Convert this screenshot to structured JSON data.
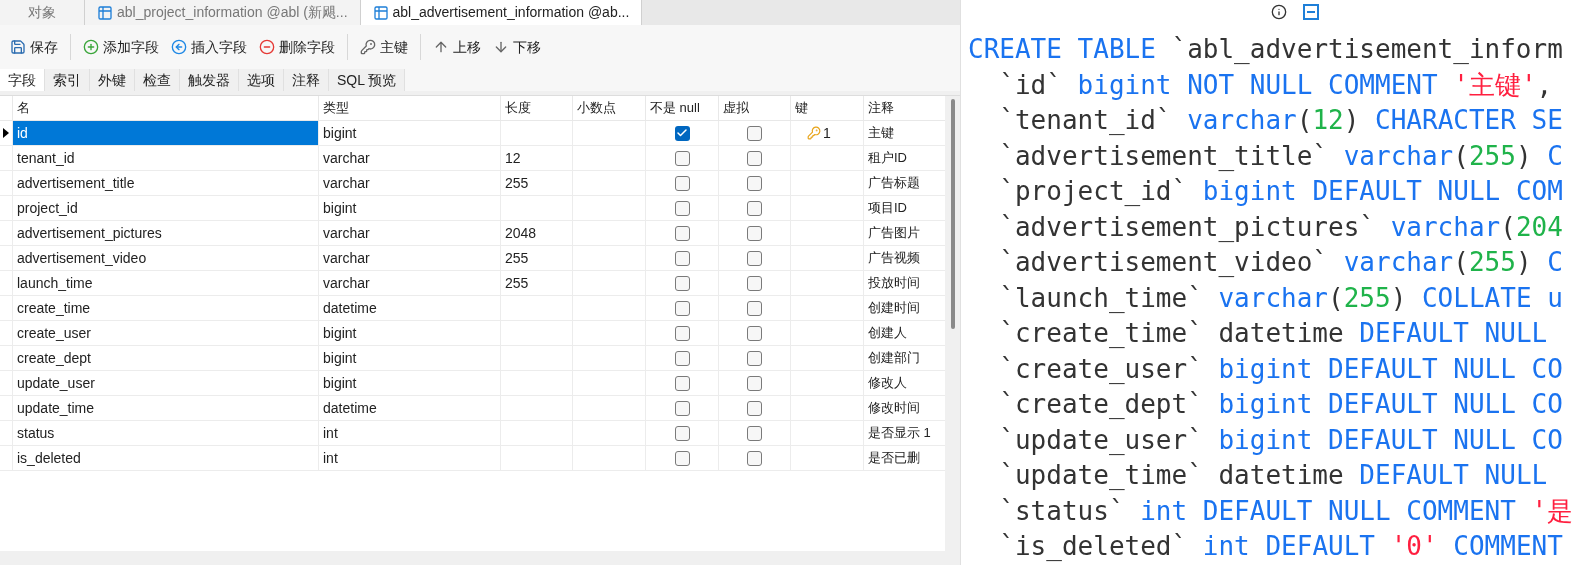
{
  "tabs": [
    {
      "label": "对象",
      "selected": false,
      "kind": "plain"
    },
    {
      "label": "abl_project_information @abl (新飓...",
      "selected": false,
      "kind": "table"
    },
    {
      "label": "abl_advertisement_information @ab...",
      "selected": true,
      "kind": "table"
    }
  ],
  "toolbar": [
    {
      "label": "保存",
      "kind": "save",
      "separator_after": true
    },
    {
      "label": "添加字段",
      "kind": "add",
      "separator_after": false
    },
    {
      "label": "插入字段",
      "kind": "insert",
      "separator_after": false
    },
    {
      "label": "删除字段",
      "kind": "delete",
      "separator_after": true
    },
    {
      "label": "主键",
      "kind": "key",
      "separator_after": true
    },
    {
      "label": "上移",
      "kind": "up",
      "separator_after": false
    },
    {
      "label": "下移",
      "kind": "down",
      "separator_after": false
    }
  ],
  "subtabs": [
    {
      "label": "字段",
      "selected": true
    },
    {
      "label": "索引",
      "selected": false
    },
    {
      "label": "外键",
      "selected": false
    },
    {
      "label": "检查",
      "selected": false
    },
    {
      "label": "触发器",
      "selected": false
    },
    {
      "label": "选项",
      "selected": false
    },
    {
      "label": "注释",
      "selected": false
    },
    {
      "label": "SQL 预览",
      "selected": false
    }
  ],
  "table": {
    "columns": [
      "名",
      "类型",
      "长度",
      "小数点",
      "不是 null",
      "虚拟",
      "键",
      "注释"
    ],
    "rows": [
      {
        "name": "id",
        "type": "bigint",
        "length": "",
        "not_null": true,
        "virtual": false,
        "key": "1",
        "comment": "主键",
        "selected": true
      },
      {
        "name": "tenant_id",
        "type": "varchar",
        "length": "12",
        "not_null": false,
        "virtual": false,
        "key": "",
        "comment": "租户ID",
        "selected": false
      },
      {
        "name": "advertisement_title",
        "type": "varchar",
        "length": "255",
        "not_null": false,
        "virtual": false,
        "key": "",
        "comment": "广告标题",
        "selected": false
      },
      {
        "name": "project_id",
        "type": "bigint",
        "length": "",
        "not_null": false,
        "virtual": false,
        "key": "",
        "comment": "项目ID",
        "selected": false
      },
      {
        "name": "advertisement_pictures",
        "type": "varchar",
        "length": "2048",
        "not_null": false,
        "virtual": false,
        "key": "",
        "comment": "广告图片",
        "selected": false
      },
      {
        "name": "advertisement_video",
        "type": "varchar",
        "length": "255",
        "not_null": false,
        "virtual": false,
        "key": "",
        "comment": "广告视频",
        "selected": false
      },
      {
        "name": "launch_time",
        "type": "varchar",
        "length": "255",
        "not_null": false,
        "virtual": false,
        "key": "",
        "comment": "投放时间",
        "selected": false
      },
      {
        "name": "create_time",
        "type": "datetime",
        "length": "",
        "not_null": false,
        "virtual": false,
        "key": "",
        "comment": "创建时间",
        "selected": false
      },
      {
        "name": "create_user",
        "type": "bigint",
        "length": "",
        "not_null": false,
        "virtual": false,
        "key": "",
        "comment": "创建人",
        "selected": false
      },
      {
        "name": "create_dept",
        "type": "bigint",
        "length": "",
        "not_null": false,
        "virtual": false,
        "key": "",
        "comment": "创建部门",
        "selected": false
      },
      {
        "name": "update_user",
        "type": "bigint",
        "length": "",
        "not_null": false,
        "virtual": false,
        "key": "",
        "comment": "修改人",
        "selected": false
      },
      {
        "name": "update_time",
        "type": "datetime",
        "length": "",
        "not_null": false,
        "virtual": false,
        "key": "",
        "comment": "修改时间",
        "selected": false
      },
      {
        "name": "status",
        "type": "int",
        "length": "",
        "not_null": false,
        "virtual": false,
        "key": "",
        "comment": "是否显示 1",
        "selected": false
      },
      {
        "name": "is_deleted",
        "type": "int",
        "length": "",
        "not_null": false,
        "virtual": false,
        "key": "",
        "comment": "是否已删",
        "selected": false
      }
    ]
  },
  "ddl": {
    "lines": [
      [
        {
          "kind": "kw",
          "text": "CREATE TABLE "
        },
        {
          "kind": "ident",
          "text": "`abl_advertisement_inform"
        }
      ],
      [
        {
          "kind": "ident",
          "text": "  `id` "
        },
        {
          "kind": "kw",
          "text": "bigint NOT NULL COMMENT "
        },
        {
          "kind": "str",
          "text": "'主键'"
        },
        {
          "kind": "ident",
          "text": ","
        }
      ],
      [
        {
          "kind": "ident",
          "text": "  `tenant_id` "
        },
        {
          "kind": "kw",
          "text": "varchar"
        },
        {
          "kind": "ident",
          "text": "("
        },
        {
          "kind": "num",
          "text": "12"
        },
        {
          "kind": "ident",
          "text": ") "
        },
        {
          "kind": "kw",
          "text": "CHARACTER SE"
        }
      ],
      [
        {
          "kind": "ident",
          "text": "  `advertisement_title` "
        },
        {
          "kind": "kw",
          "text": "varchar"
        },
        {
          "kind": "ident",
          "text": "("
        },
        {
          "kind": "num",
          "text": "255"
        },
        {
          "kind": "ident",
          "text": ") "
        },
        {
          "kind": "kw",
          "text": "C"
        }
      ],
      [
        {
          "kind": "ident",
          "text": "  `project_id` "
        },
        {
          "kind": "kw",
          "text": "bigint DEFAULT NULL COM"
        }
      ],
      [
        {
          "kind": "ident",
          "text": "  `advertisement_pictures` "
        },
        {
          "kind": "kw",
          "text": "varchar"
        },
        {
          "kind": "ident",
          "text": "("
        },
        {
          "kind": "num",
          "text": "204"
        }
      ],
      [
        {
          "kind": "ident",
          "text": "  `advertisement_video` "
        },
        {
          "kind": "kw",
          "text": "varchar"
        },
        {
          "kind": "ident",
          "text": "("
        },
        {
          "kind": "num",
          "text": "255"
        },
        {
          "kind": "ident",
          "text": ") "
        },
        {
          "kind": "kw",
          "text": "C"
        }
      ],
      [
        {
          "kind": "ident",
          "text": "  `launch_time` "
        },
        {
          "kind": "kw",
          "text": "varchar"
        },
        {
          "kind": "ident",
          "text": "("
        },
        {
          "kind": "num",
          "text": "255"
        },
        {
          "kind": "ident",
          "text": ") "
        },
        {
          "kind": "kw",
          "text": "COLLATE u"
        }
      ],
      [
        {
          "kind": "ident",
          "text": "  `create_time` datetime "
        },
        {
          "kind": "kw",
          "text": "DEFAULT NULL"
        }
      ],
      [
        {
          "kind": "ident",
          "text": "  `create_user` "
        },
        {
          "kind": "kw",
          "text": "bigint DEFAULT NULL CO"
        }
      ],
      [
        {
          "kind": "ident",
          "text": "  `create_dept` "
        },
        {
          "kind": "kw",
          "text": "bigint DEFAULT NULL CO"
        }
      ],
      [
        {
          "kind": "ident",
          "text": "  `update_user` "
        },
        {
          "kind": "kw",
          "text": "bigint DEFAULT NULL CO"
        }
      ],
      [
        {
          "kind": "ident",
          "text": "  `update_time` datetime "
        },
        {
          "kind": "kw",
          "text": "DEFAULT NULL"
        }
      ],
      [
        {
          "kind": "ident",
          "text": "  `status` "
        },
        {
          "kind": "kw",
          "text": "int DEFAULT NULL COMMENT "
        },
        {
          "kind": "str",
          "text": "'是"
        }
      ],
      [
        {
          "kind": "ident",
          "text": "  `is_deleted` "
        },
        {
          "kind": "kw",
          "text": "int DEFAULT "
        },
        {
          "kind": "str",
          "text": "'0'"
        },
        {
          "kind": "kw",
          "text": " COMMENT"
        }
      ]
    ]
  }
}
